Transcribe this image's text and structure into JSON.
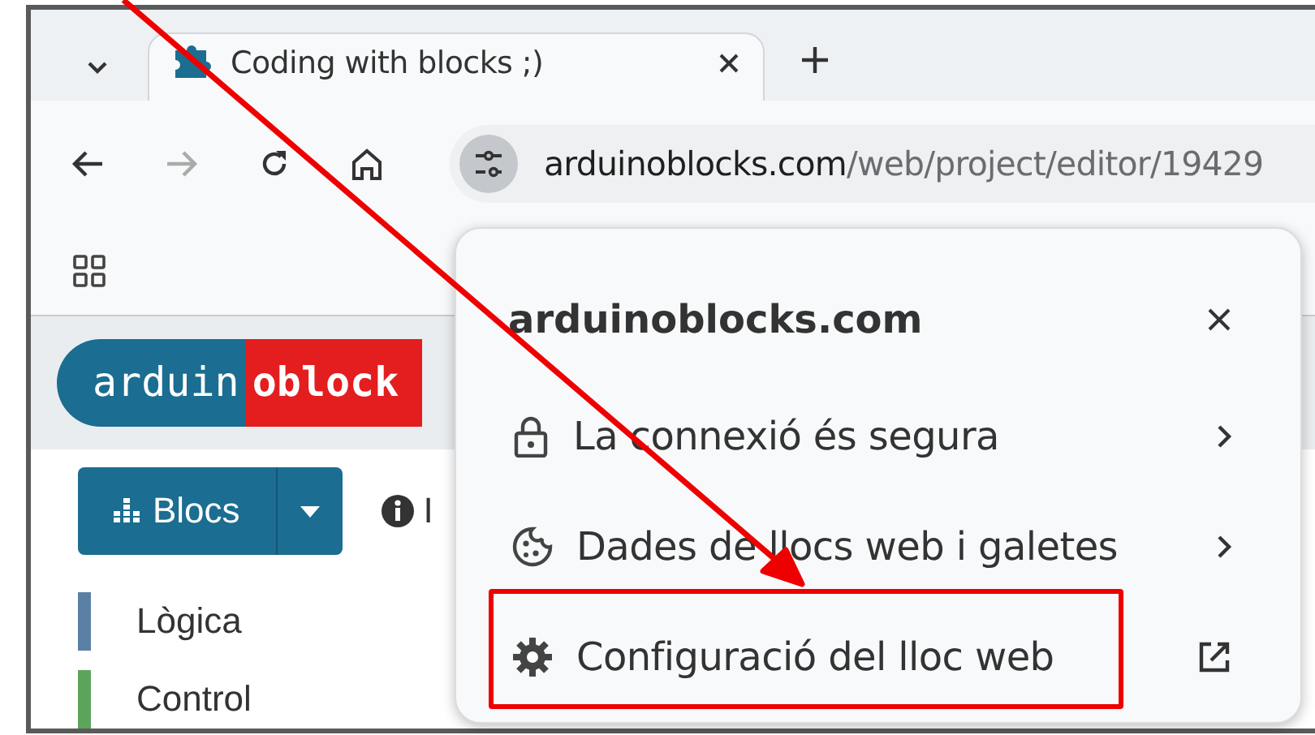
{
  "tabs": [
    {
      "title": "Coding with blocks ;)",
      "selected": true
    }
  ],
  "address": {
    "domain": "arduinoblocks.com",
    "path": "/web/project/editor/19429"
  },
  "page": {
    "logo": [
      "arduin",
      "oblock"
    ],
    "toolbar": [
      {
        "label": "Blocs",
        "kind": "split"
      },
      {
        "label": "I",
        "kind": "info"
      }
    ],
    "categories": [
      {
        "label": "Lògica",
        "color": "#5b80a5"
      },
      {
        "label": "Control",
        "color": "#5ba55b"
      }
    ]
  },
  "site_info": {
    "title": "arduinoblocks.com",
    "items": [
      {
        "label": "La connexió és segura",
        "kind": "lock",
        "opens_externally": false,
        "highlighted": false
      },
      {
        "label": "Dades de llocs web i galetes",
        "kind": "cookie",
        "opens_externally": false,
        "highlighted": false
      },
      {
        "label": "Configuració del lloc web",
        "kind": "gear",
        "opens_externally": true,
        "highlighted": true
      }
    ]
  },
  "pointer_arrow": true
}
